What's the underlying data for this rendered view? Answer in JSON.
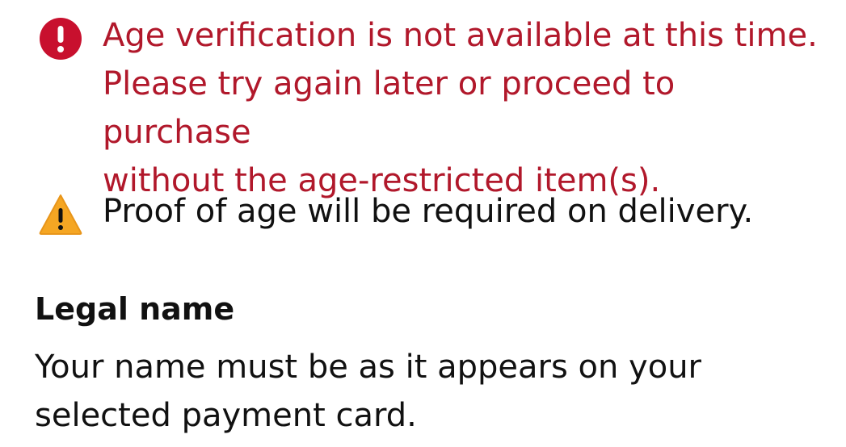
{
  "error_alert": {
    "icon": "exclamation-circle-icon",
    "color": "#b1182b",
    "lines": [
      "Age verification is not available at this time.",
      "Please try again later or proceed to purchase",
      "without the age-restricted item(s)."
    ]
  },
  "warning_alert": {
    "icon": "warning-triangle-icon",
    "color": "#f5a623",
    "text": "Proof of age will be required on delivery."
  },
  "legal_name": {
    "title": "Legal name",
    "description_lines": [
      "Your name must be as it appears on your",
      "selected payment card."
    ]
  }
}
